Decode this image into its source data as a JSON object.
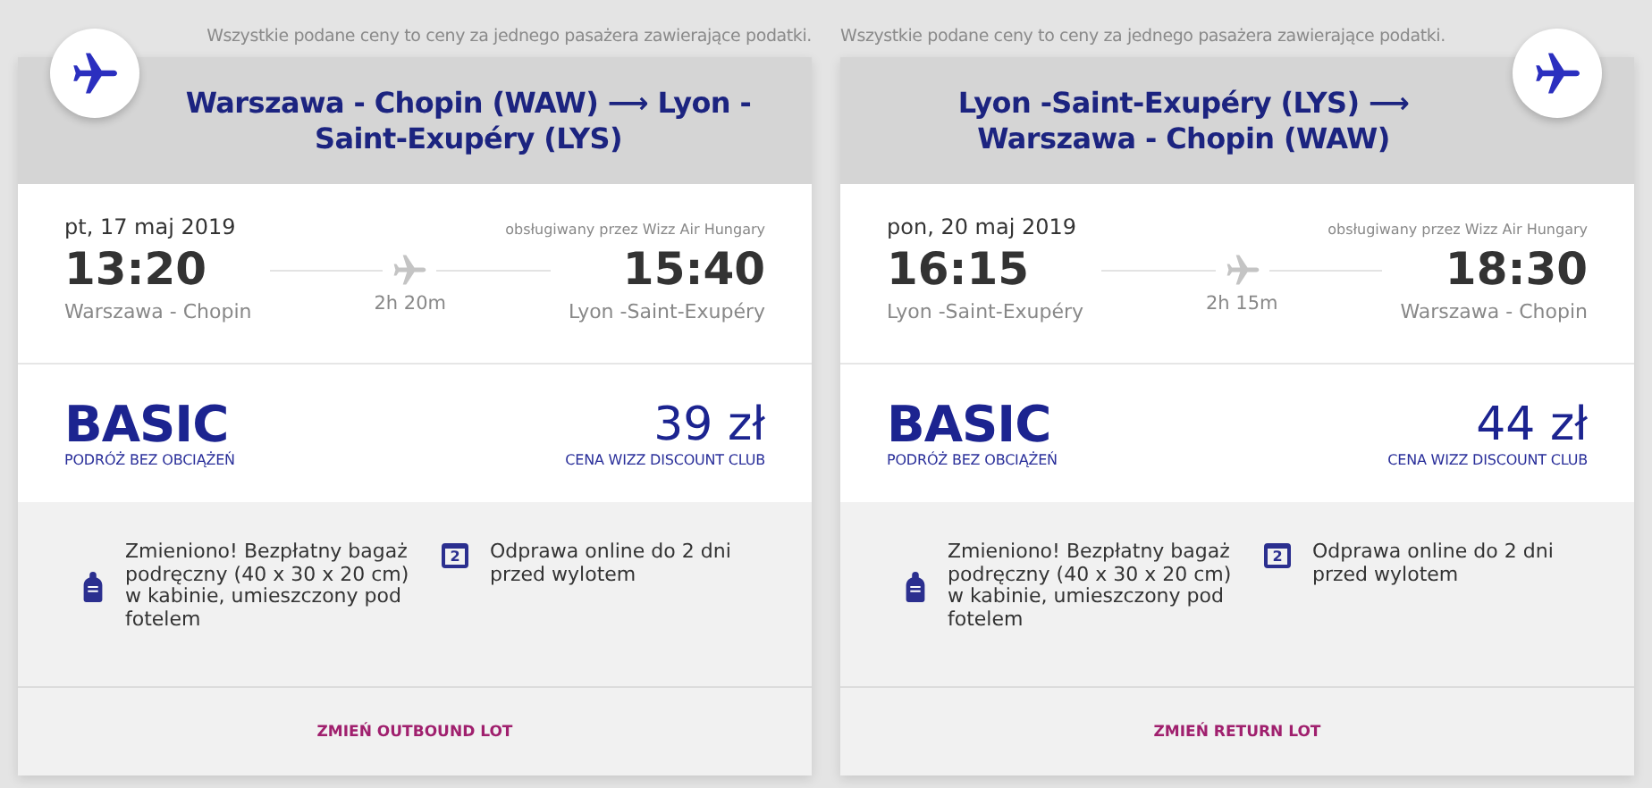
{
  "flights": [
    {
      "note": "Wszystkie podane ceny to ceny za jednego pasażera zawierające podatki.",
      "kind": "outbound",
      "route": "Warszawa - Chopin (WAW) ⟶ Lyon - Saint-Exupéry (LYS)",
      "date": "pt, 17 maj 2019",
      "operator": "obsługiwany przez Wizz Air Hungary",
      "departure_time": "13:20",
      "departure_airport": "Warszawa - Chopin",
      "duration": "2h 20m",
      "arrival_time": "15:40",
      "arrival_airport": "Lyon -Saint-Exupéry",
      "fare": "BASIC",
      "fare_subtitle": "PODRÓŻ BEZ OBCIĄŻEŃ",
      "price": "39 zł",
      "price_label": "CENA WIZZ DISCOUNT CLUB",
      "features": [
        {
          "kind": "bag",
          "text": "Zmieniono! Bezpłatny bagaż podręczny (40 x 30 x 20 cm) w kabinie, umieszczony pod fotelem"
        },
        {
          "kind": "calendar",
          "icon_text": "2",
          "text": "Odprawa online do 2 dni przed wylotem"
        }
      ],
      "change_button": "ZMIEŃ OUTBOUND LOT"
    },
    {
      "note": "Wszystkie podane ceny to ceny za jednego pasażera zawierające podatki.",
      "kind": "return",
      "route": "Lyon -Saint-Exupéry (LYS) ⟶ Warszawa - Chopin (WAW)",
      "date": "pon, 20 maj 2019",
      "operator": "obsługiwany przez Wizz Air Hungary",
      "departure_time": "16:15",
      "departure_airport": "Lyon -Saint-Exupéry",
      "duration": "2h 15m",
      "arrival_time": "18:30",
      "arrival_airport": "Warszawa - Chopin",
      "fare": "BASIC",
      "fare_subtitle": "PODRÓŻ BEZ OBCIĄŻEŃ",
      "price": "44 zł",
      "price_label": "CENA WIZZ DISCOUNT CLUB",
      "features": [
        {
          "kind": "bag",
          "text": "Zmieniono! Bezpłatny bagaż podręczny (40 x 30 x 20 cm) w kabinie, umieszczony pod fotelem"
        },
        {
          "kind": "calendar",
          "icon_text": "2",
          "text": "Odprawa online do 2 dni przed wylotem"
        }
      ],
      "change_button": "ZMIEŃ RETURN LOT"
    }
  ]
}
